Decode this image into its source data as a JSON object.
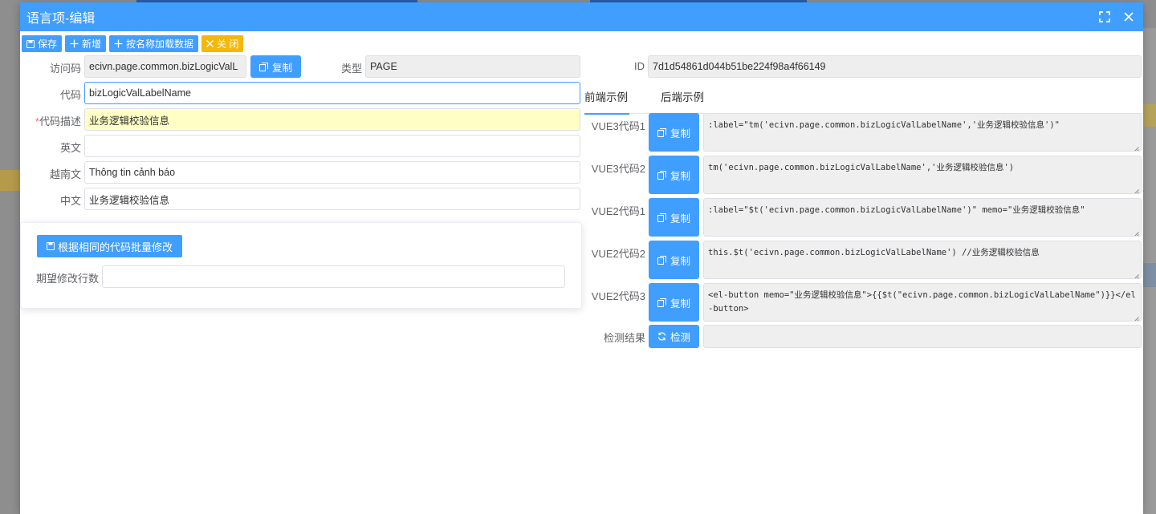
{
  "dialog": {
    "title": "语言项-编辑"
  },
  "toolbar": {
    "save_label": "保存",
    "add_label": "新增",
    "load_by_name_label": "按名称加载数据",
    "close_label": "关 闭"
  },
  "form": {
    "access_code_label": "访问码",
    "access_code_value": "ecivn.page.common.bizLogicValL",
    "copy_label": "复制",
    "type_label": "类型",
    "type_value": "PAGE",
    "id_label": "ID",
    "id_value": "7d1d54861d044b51be224f98a4f66149",
    "code_label": "代码",
    "code_value": "bizLogicValLabelName",
    "desc_required_mark": "*",
    "desc_label": "代码描述",
    "desc_value": "业务逻辑校验信息",
    "english_label": "英文",
    "english_value": "",
    "vietnamese_label": "越南文",
    "vietnamese_value": "Thông tin cảnh báo",
    "chinese_label": "中文",
    "chinese_value": "业务逻辑校验信息"
  },
  "batch": {
    "button_label": "根据相同的代码批量修改",
    "expected_rows_label": "期望修改行数",
    "expected_rows_value": ""
  },
  "tabs": [
    {
      "label": "前端示例",
      "active": true
    },
    {
      "label": "后端示例",
      "active": false
    }
  ],
  "examples": [
    {
      "label": "VUE3代码1",
      "button": "复制",
      "code": ":label=\"tm('ecivn.page.common.bizLogicValLabelName','业务逻辑校验信息')\""
    },
    {
      "label": "VUE3代码2",
      "button": "复制",
      "code": "tm('ecivn.page.common.bizLogicValLabelName','业务逻辑校验信息')"
    },
    {
      "label": "VUE2代码1",
      "button": "复制",
      "code": ":label=\"$t('ecivn.page.common.bizLogicValLabelName')\" memo=\"业务逻辑校验信息\""
    },
    {
      "label": "VUE2代码2",
      "button": "复制",
      "code": "this.$t('ecivn.page.common.bizLogicValLabelName') //业务逻辑校验信息"
    },
    {
      "label": "VUE2代码3",
      "button": "复制",
      "code": "<el-button memo=\"业务逻辑校验信息\">{{$t(\"ecivn.page.common.bizLogicValLabelName\")}}</el-button>"
    }
  ],
  "check": {
    "label": "检测结果",
    "button": "检测",
    "result": ""
  },
  "colors": {
    "primary": "#409eff",
    "warning": "#f5b70a",
    "required": "#f56c6c",
    "highlight_field": "#ffffc5"
  }
}
